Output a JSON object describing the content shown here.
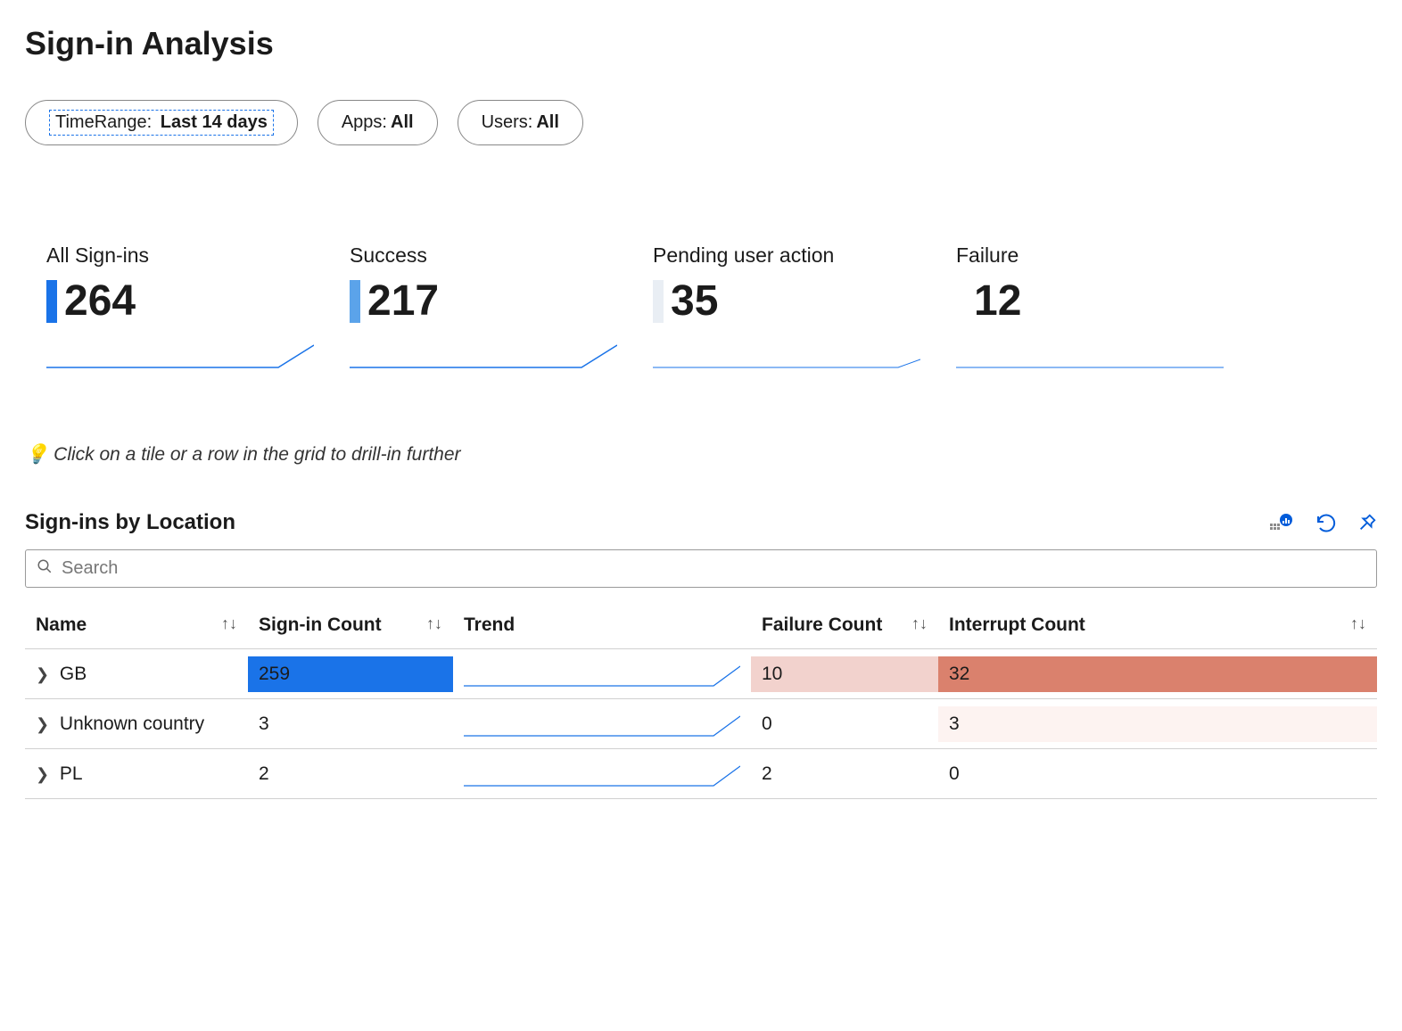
{
  "title": "Sign-in Analysis",
  "filters": {
    "timerange_label": "TimeRange:",
    "timerange_value": "Last 14 days",
    "apps_label": "Apps:",
    "apps_value": "All",
    "users_label": "Users:",
    "users_value": "All"
  },
  "tiles": {
    "all": {
      "label": "All Sign-ins",
      "value": "264",
      "bar_color": "#1a73e8"
    },
    "success": {
      "label": "Success",
      "value": "217",
      "bar_color": "#5ba3ea"
    },
    "pending": {
      "label": "Pending user action",
      "value": "35",
      "bar_color": "#e9eef4"
    },
    "failure": {
      "label": "Failure",
      "value": "12",
      "bar_color": "#ffffff"
    }
  },
  "hint_text": "Click on a tile or a row in the grid to drill-in further",
  "section_title": "Sign-ins by Location",
  "search_placeholder": "Search",
  "columns": {
    "name": "Name",
    "signin_count": "Sign-in Count",
    "trend": "Trend",
    "failure_count": "Failure Count",
    "interrupt_count": "Interrupt Count"
  },
  "rows": [
    {
      "name": "GB",
      "signin_count": "259",
      "failure_count": "10",
      "interrupt_count": "32",
      "signin_bg": "#1a73e8",
      "signin_fg": "#1b1b1b",
      "signin_w": 100,
      "failure_bg": "#f2d2cd",
      "interrupt_bg": "#da816d"
    },
    {
      "name": "Unknown country",
      "signin_count": "3",
      "failure_count": "0",
      "interrupt_count": "3",
      "signin_bg": "transparent",
      "signin_fg": "#1b1b1b",
      "signin_w": 0,
      "failure_bg": "transparent",
      "interrupt_bg": "#fdf3f1"
    },
    {
      "name": "PL",
      "signin_count": "2",
      "failure_count": "2",
      "interrupt_count": "0",
      "signin_bg": "transparent",
      "signin_fg": "#1b1b1b",
      "signin_w": 0,
      "failure_bg": "transparent",
      "interrupt_bg": "transparent"
    }
  ],
  "chart_data": {
    "type": "table",
    "title": "Sign-ins by Location",
    "columns": [
      "Name",
      "Sign-in Count",
      "Failure Count",
      "Interrupt Count"
    ],
    "rows": [
      [
        "GB",
        259,
        10,
        32
      ],
      [
        "Unknown country",
        3,
        0,
        3
      ],
      [
        "PL",
        2,
        2,
        0
      ]
    ],
    "summary_tiles": {
      "All Sign-ins": 264,
      "Success": 217,
      "Pending user action": 35,
      "Failure": 12
    }
  }
}
